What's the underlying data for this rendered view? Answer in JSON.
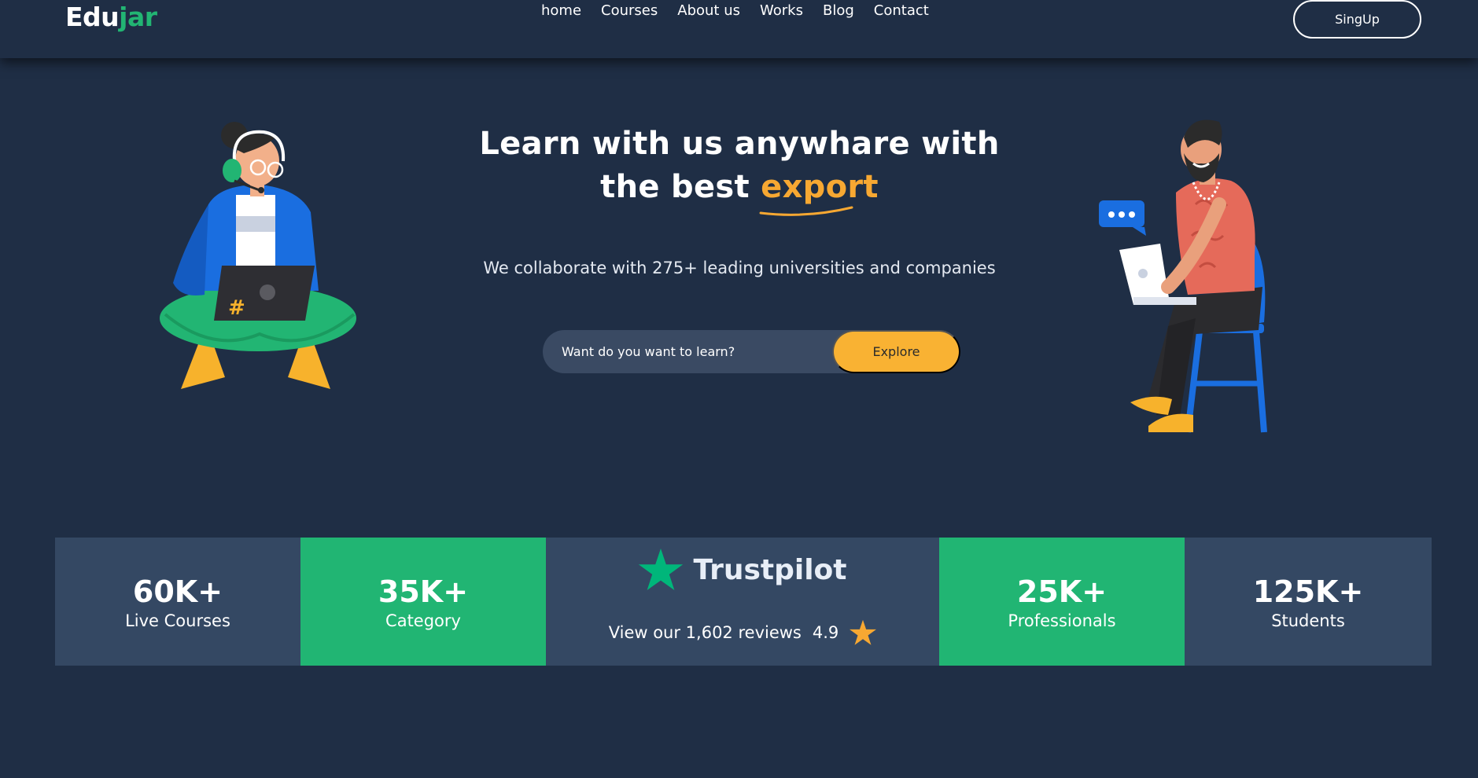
{
  "brand": {
    "name_part1": "Edu",
    "name_part2": "jar"
  },
  "nav": {
    "items": [
      "home",
      "Courses",
      "About us",
      "Works",
      "Blog",
      "Contact"
    ],
    "signup_label": "SingUp"
  },
  "hero": {
    "title_line1": "Learn with us anywhare with",
    "title_line2_prefix": "the best ",
    "title_highlight": "export",
    "subtitle": "We collaborate with 275+ leading universities and companies",
    "search_placeholder": "Want do you want to learn?",
    "explore_label": "Explore"
  },
  "stats": {
    "live_courses": {
      "value": "60K+",
      "label": "Live Courses"
    },
    "category": {
      "value": "35K+",
      "label": "Category"
    },
    "trustpilot": {
      "name": "Trustpilot",
      "reviews": "View our 1,602 reviews",
      "rating": "4.9"
    },
    "professionals": {
      "value": "25K+",
      "label": "Professionals"
    },
    "students": {
      "value": "125K+",
      "label": "Students"
    }
  },
  "next_section": {
    "heading": ""
  },
  "colors": {
    "background": "#1f2e45",
    "accent_green": "#21b573",
    "accent_orange": "#f9b233",
    "card_blue": "#344863"
  },
  "icons": [
    "trustpilot-star-icon",
    "rating-star-icon"
  ]
}
